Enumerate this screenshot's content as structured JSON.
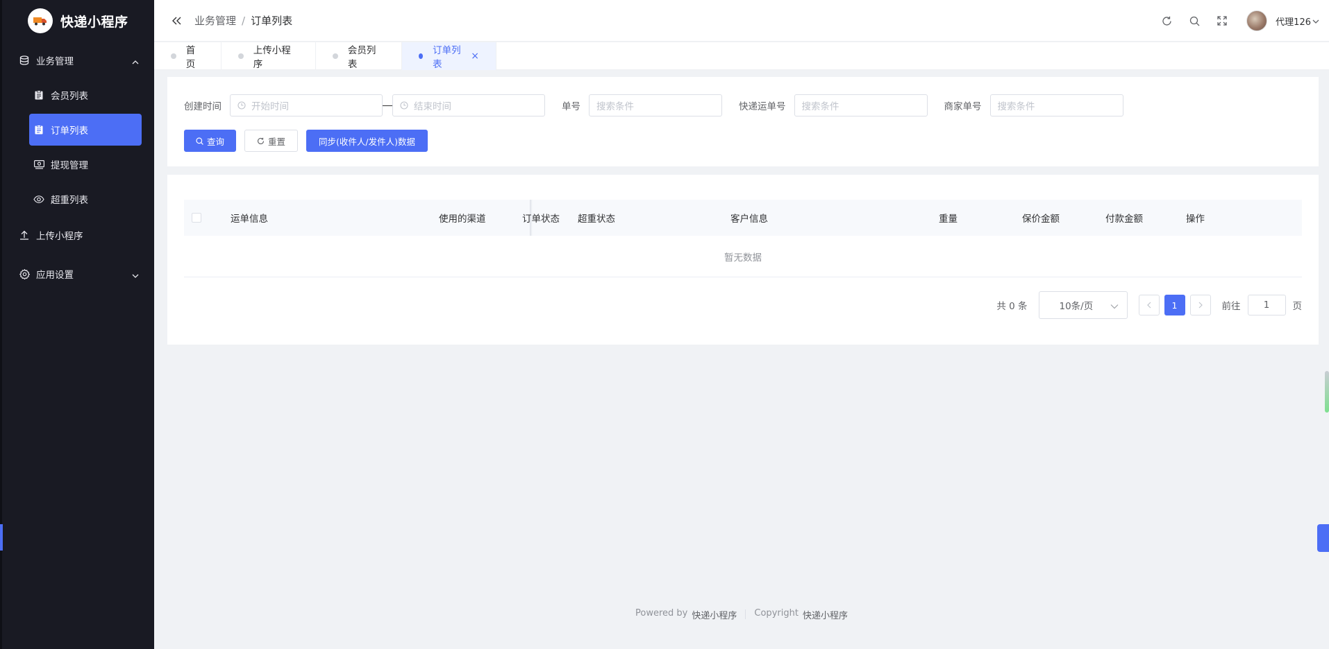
{
  "app": {
    "title": "快递小程序"
  },
  "sidebar": {
    "groups": [
      {
        "label": "业务管理",
        "icon": "database-icon",
        "expanded": true,
        "children": [
          {
            "label": "会员列表",
            "icon": "clipboard-icon",
            "active": false
          },
          {
            "label": "订单列表",
            "icon": "clipboard-icon",
            "active": true
          },
          {
            "label": "提现管理",
            "icon": "cash-icon",
            "active": false
          },
          {
            "label": "超重列表",
            "icon": "eye-icon",
            "active": false
          }
        ]
      },
      {
        "label": "上传小程序",
        "icon": "upload-icon"
      },
      {
        "label": "应用设置",
        "icon": "gear-icon",
        "expanded": false
      }
    ]
  },
  "header": {
    "breadcrumb": [
      "业务管理",
      "订单列表"
    ],
    "breadcrumb_separator": "/",
    "username": "代理126"
  },
  "tabs": [
    {
      "label": "首页",
      "active": false
    },
    {
      "label": "上传小程序",
      "active": false
    },
    {
      "label": "会员列表",
      "active": false
    },
    {
      "label": "订单列表",
      "active": true,
      "close": "×"
    }
  ],
  "search": {
    "created_time_label": "创建时间",
    "start_placeholder": "开始时间",
    "end_placeholder": "结束时间",
    "order_no_label": "单号",
    "order_no_placeholder": "搜索条件",
    "express_no_label": "快递运单号",
    "express_no_placeholder": "搜索条件",
    "merchant_no_label": "商家单号",
    "merchant_no_placeholder": "搜索条件",
    "query_button": "查询",
    "reset_button": "重置",
    "sync_button": "同步(收件人/发件人)数据"
  },
  "table": {
    "columns": [
      "运单信息",
      "使用的渠道",
      "订单状态",
      "超重状态",
      "客户信息",
      "重量",
      "保价金额",
      "付款金额",
      "操作"
    ],
    "empty_text": "暂无数据"
  },
  "pagination": {
    "total_text": "共 0 条",
    "page_size": "10条/页",
    "current_page": "1",
    "goto_label": "前往",
    "goto_value": "1",
    "page_suffix": "页"
  },
  "footer": {
    "powered_label": "Powered by",
    "powered_brand": "快递小程序",
    "copyright_label": "Copyright",
    "copyright_brand": "快递小程序"
  },
  "colors": {
    "sidebar_bg": "#191a23",
    "accent": "#4c6ef5",
    "page_bg": "#f0f2f5"
  }
}
